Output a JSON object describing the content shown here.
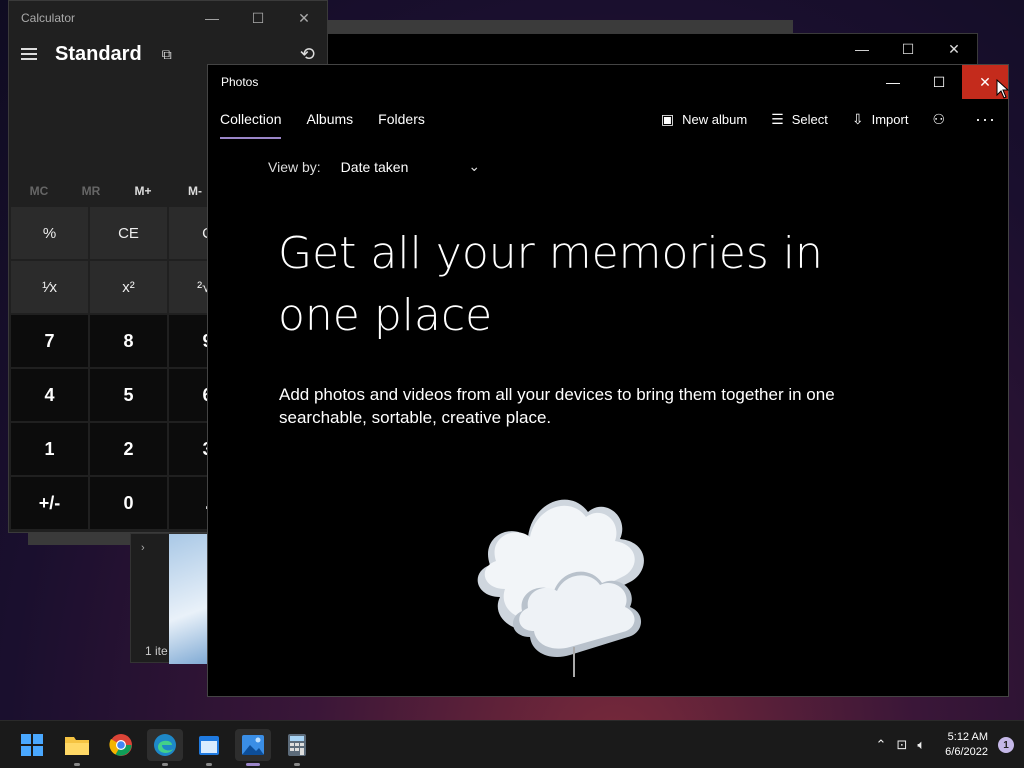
{
  "calculator": {
    "title": "Calculator",
    "mode": "Standard",
    "memory": [
      "MC",
      "MR",
      "M+",
      "M-"
    ],
    "keys": [
      {
        "label": "%",
        "kind": "fn"
      },
      {
        "label": "CE",
        "kind": "fn"
      },
      {
        "label": "C",
        "kind": "fn"
      },
      {
        "label": "¹⁄x",
        "kind": "fn"
      },
      {
        "label": "x²",
        "kind": "fn"
      },
      {
        "label": "²√x",
        "kind": "fn"
      },
      {
        "label": "7",
        "kind": "num"
      },
      {
        "label": "8",
        "kind": "num"
      },
      {
        "label": "9",
        "kind": "num"
      },
      {
        "label": "4",
        "kind": "num"
      },
      {
        "label": "5",
        "kind": "num"
      },
      {
        "label": "6",
        "kind": "num"
      },
      {
        "label": "1",
        "kind": "num"
      },
      {
        "label": "2",
        "kind": "num"
      },
      {
        "label": "3",
        "kind": "num"
      },
      {
        "label": "+/-",
        "kind": "num"
      },
      {
        "label": "0",
        "kind": "num"
      },
      {
        "label": ".",
        "kind": "num"
      }
    ]
  },
  "explorer": {
    "item_count": "1 ite"
  },
  "photos": {
    "title": "Photos",
    "tabs": [
      "Collection",
      "Albums",
      "Folders"
    ],
    "toolbar": {
      "new_album": "New album",
      "select": "Select",
      "import": "Import"
    },
    "view_by_label": "View by:",
    "view_by_value": "Date taken",
    "hero_title": "Get all your memories in one place",
    "description": "Add photos and videos from all your devices to bring them together in one searchable, sortable, creative place."
  },
  "taskbar": {
    "time": "5:12 AM",
    "date": "6/6/2022",
    "notification_count": "1",
    "accent": "#9b86c9"
  }
}
